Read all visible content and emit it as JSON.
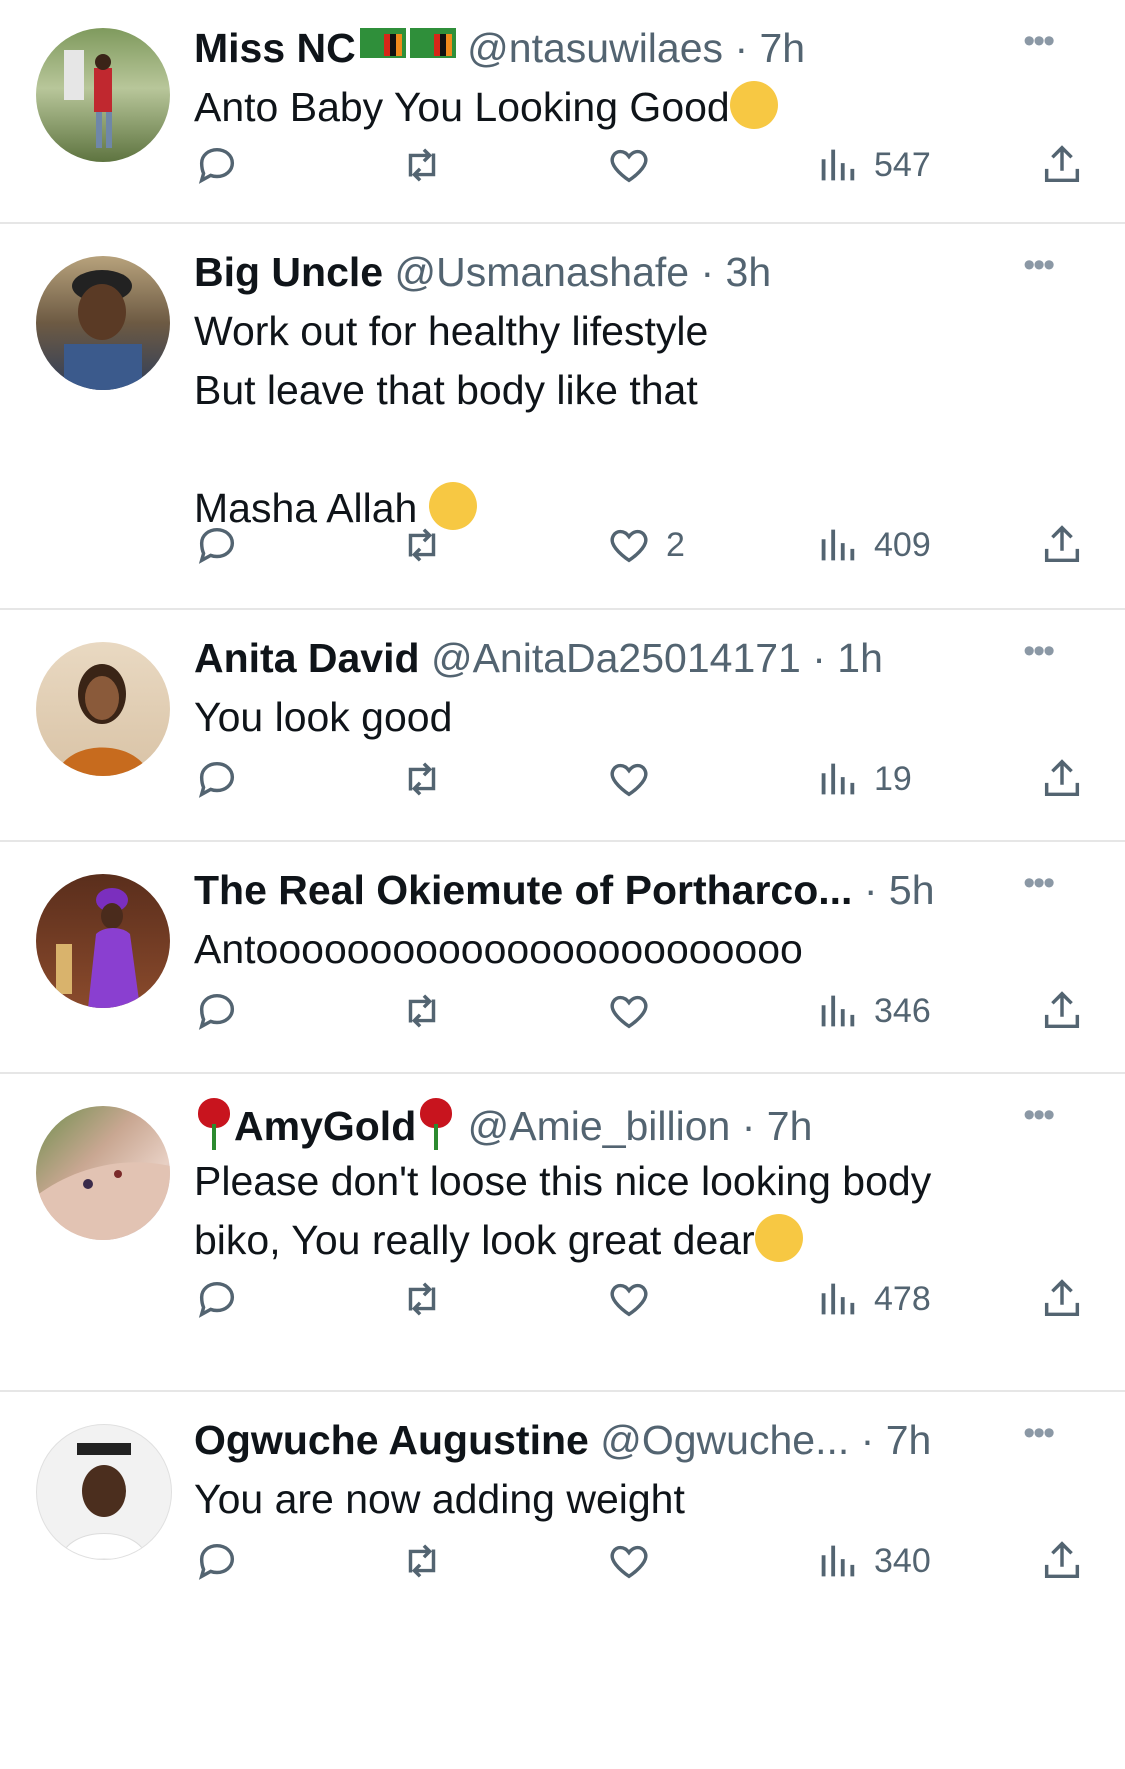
{
  "tweets": [
    {
      "name": "Miss NC",
      "name_emoji": [
        "zambia-flag",
        "zambia-flag"
      ],
      "handle": "@ntasuwilaes",
      "time": "· 7h",
      "text": "Anto Baby You Looking Good",
      "text_emoji": "smiling-face-with-hearts",
      "likes": "",
      "views": "547"
    },
    {
      "name": "Big Uncle",
      "handle": "@Usmanashafe",
      "time": "· 3h",
      "text": "Work out for healthy lifestyle\nBut leave that body like that\n\nMasha Allah ",
      "text_emoji": "grinning-face",
      "likes": "2",
      "views": "409"
    },
    {
      "name": "Anita David",
      "handle": "@AnitaDa25014171",
      "time": "· 1h",
      "text": "You look good",
      "likes": "",
      "views": "19"
    },
    {
      "name": "The Real Okiemute of Portharco...",
      "handle": "",
      "time": "· 5h",
      "text": "Antoooooooooooooooooooooooo",
      "likes": "",
      "views": "346"
    },
    {
      "name": "AmyGold",
      "name_emoji": [
        "rose",
        "rose"
      ],
      "handle": "@Amie_billion",
      "time": "· 7h",
      "text": "Please don't loose this nice looking body\nbiko, You really look great dear",
      "text_emoji": "face-blowing-kiss",
      "likes": "",
      "views": "478"
    },
    {
      "name": "Ogwuche Augustine",
      "handle": "@Ogwuche...",
      "time": "· 7h",
      "text": "You are now adding weight",
      "likes": "",
      "views": "340"
    }
  ],
  "icons": {
    "reply": "reply-icon",
    "retweet": "retweet-icon",
    "like": "like-icon",
    "views": "views-icon",
    "share": "share-icon",
    "more": "more-icon"
  },
  "colors": {
    "text": "#0f1419",
    "muted": "#536471",
    "divider": "#e6e6e6"
  }
}
